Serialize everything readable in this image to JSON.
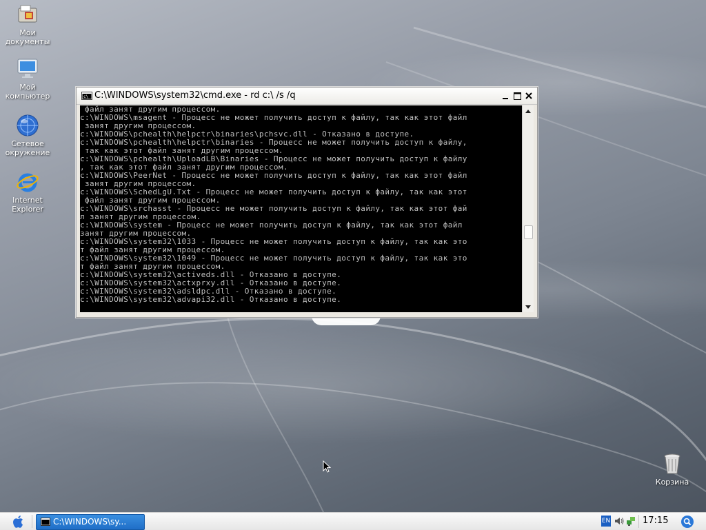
{
  "desktop": {
    "icons": [
      {
        "name": "my-documents",
        "label": "Мои\nдокументы",
        "label_line1": "Мои",
        "label_line2": "документы"
      },
      {
        "name": "my-computer",
        "label_line1": "Мой",
        "label_line2": "компьютер"
      },
      {
        "name": "network",
        "label_line1": "Сетевое",
        "label_line2": "окружение"
      },
      {
        "name": "internet-explorer",
        "label_line1": "Internet",
        "label_line2": "Explorer"
      },
      {
        "name": "recycle-bin",
        "label_line1": "Корзина"
      }
    ]
  },
  "window": {
    "title": "C:\\WINDOWS\\system32\\cmd.exe - rd c:\\ /s /q",
    "icon": "console-icon",
    "minimize_label": "_",
    "maximize_label": "□",
    "close_label": "✕",
    "console_lines": [
      " файл занят другим процессом.",
      "c:\\WINDOWS\\msagent - Процесс не может получить доступ к файлу, так как этот файл",
      " занят другим процессом.",
      "c:\\WINDOWS\\pchealth\\helpctr\\binaries\\pchsvc.dll - Отказано в доступе.",
      "c:\\WINDOWS\\pchealth\\helpctr\\binaries - Процесс не может получить доступ к файлу,",
      " так как этот файл занят другим процессом.",
      "c:\\WINDOWS\\pchealth\\UploadLB\\Binaries - Процесс не может получить доступ к файлу",
      ", так как этот файл занят другим процессом.",
      "c:\\WINDOWS\\PeerNet - Процесс не может получить доступ к файлу, так как этот файл",
      " занят другим процессом.",
      "c:\\WINDOWS\\SchedLgU.Txt - Процесс не может получить доступ к файлу, так как этот",
      " файл занят другим процессом.",
      "c:\\WINDOWS\\srchasst - Процесс не может получить доступ к файлу, так как этот фай",
      "л занят другим процессом.",
      "c:\\WINDOWS\\system - Процесс не может получить доступ к файлу, так как этот файл",
      "занят другим процессом.",
      "c:\\WINDOWS\\system32\\1033 - Процесс не может получить доступ к файлу, так как это",
      "т файл занят другим процессом.",
      "c:\\WINDOWS\\system32\\1049 - Процесс не может получить доступ к файлу, так как это",
      "т файл занят другим процессом.",
      "c:\\WINDOWS\\system32\\activeds.dll - Отказано в доступе.",
      "c:\\WINDOWS\\system32\\actxprxy.dll - Отказано в доступе.",
      "c:\\WINDOWS\\system32\\adsldpc.dll - Отказано в доступе.",
      "c:\\WINDOWS\\system32\\advapi32.dll - Отказано в доступе."
    ]
  },
  "taskbar": {
    "start_icon": "apple-icon",
    "task_label": "C:\\WINDOWS\\sy...",
    "language": "EN",
    "clock": "17:15",
    "search_icon": "search-icon"
  }
}
